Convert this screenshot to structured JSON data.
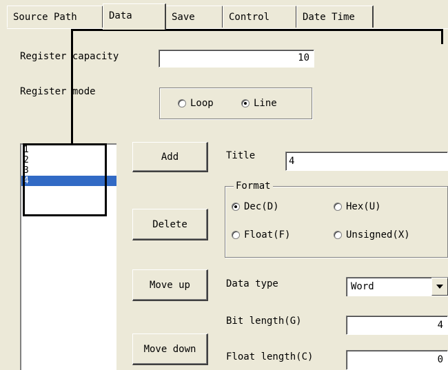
{
  "tabs": [
    "Source Path",
    "Data",
    "Save",
    "Control",
    "Date Time"
  ],
  "register": {
    "capacity_label": "Register capacity",
    "capacity_value": "10",
    "mode_label": "Register mode",
    "mode_options": [
      "Loop",
      "Line"
    ],
    "mode_selected": "Line"
  },
  "list": {
    "items": [
      "1",
      "2",
      "3",
      "4"
    ],
    "selected": "4"
  },
  "buttons": {
    "add": "Add",
    "delete": "Delete",
    "move_up": "Move up",
    "move_down": "Move down"
  },
  "title_label": "Title",
  "title_value": "4",
  "format": {
    "label": "Format",
    "options": [
      "Dec(D)",
      "Hex(U)",
      "Float(F)",
      "Unsigned(X)"
    ],
    "selected": "Dec(D)"
  },
  "data_type": {
    "label": "Data type",
    "value": "Word"
  },
  "bit_length": {
    "label": "Bit length(G)",
    "value": "4"
  },
  "float_length": {
    "label": "Float length(C)",
    "value": "0"
  }
}
